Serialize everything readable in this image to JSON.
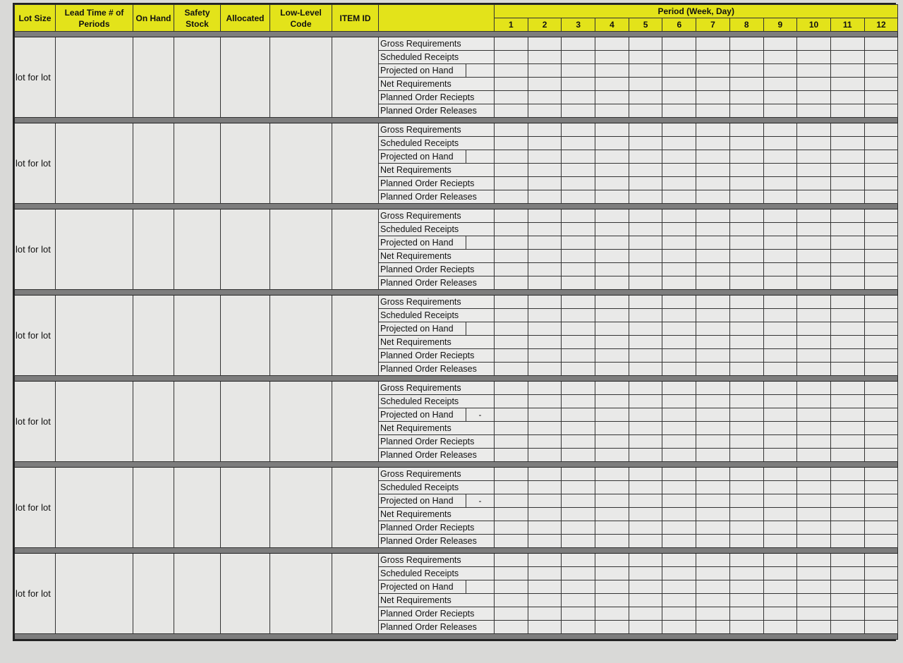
{
  "header": {
    "columns": [
      {
        "key": "lot_size",
        "label": "Lot Size"
      },
      {
        "key": "lead_time",
        "label": "Lead Time # of Periods"
      },
      {
        "key": "on_hand",
        "label": "On Hand"
      },
      {
        "key": "safety_stock",
        "label": "Safety Stock"
      },
      {
        "key": "allocated",
        "label": "Allocated"
      },
      {
        "key": "low_level_code",
        "label": "Low-Level Code"
      },
      {
        "key": "item_id",
        "label": "ITEM ID"
      }
    ],
    "period_title": "Period (Week, Day)",
    "periods": [
      "1",
      "2",
      "3",
      "4",
      "5",
      "6",
      "7",
      "8",
      "9",
      "10",
      "11",
      "12"
    ]
  },
  "row_labels": [
    "Gross Requirements",
    "Scheduled Receipts",
    "Projected on Hand",
    "Net Requirements",
    "Planned Order Reciepts",
    "Planned Order Releases"
  ],
  "blocks": [
    {
      "lot_size": "lot for lot",
      "lead_time": "",
      "on_hand": "",
      "safety_stock": "",
      "allocated": "",
      "low_level_code": "",
      "item_id": "",
      "projected_on_hand_initial": ""
    },
    {
      "lot_size": "lot for lot",
      "lead_time": "",
      "on_hand": "",
      "safety_stock": "",
      "allocated": "",
      "low_level_code": "",
      "item_id": "",
      "projected_on_hand_initial": ""
    },
    {
      "lot_size": "lot for lot",
      "lead_time": "",
      "on_hand": "",
      "safety_stock": "",
      "allocated": "",
      "low_level_code": "",
      "item_id": "",
      "projected_on_hand_initial": ""
    },
    {
      "lot_size": "lot for lot",
      "lead_time": "",
      "on_hand": "",
      "safety_stock": "",
      "allocated": "",
      "low_level_code": "",
      "item_id": "",
      "projected_on_hand_initial": ""
    },
    {
      "lot_size": "lot for lot",
      "lead_time": "",
      "on_hand": "",
      "safety_stock": "",
      "allocated": "",
      "low_level_code": "",
      "item_id": "",
      "projected_on_hand_initial": "-"
    },
    {
      "lot_size": "lot for lot",
      "lead_time": "",
      "on_hand": "",
      "safety_stock": "",
      "allocated": "",
      "low_level_code": "",
      "item_id": "",
      "projected_on_hand_initial": "-"
    },
    {
      "lot_size": "lot for lot",
      "lead_time": "",
      "on_hand": "",
      "safety_stock": "",
      "allocated": "",
      "low_level_code": "",
      "item_id": "",
      "projected_on_hand_initial": ""
    }
  ]
}
